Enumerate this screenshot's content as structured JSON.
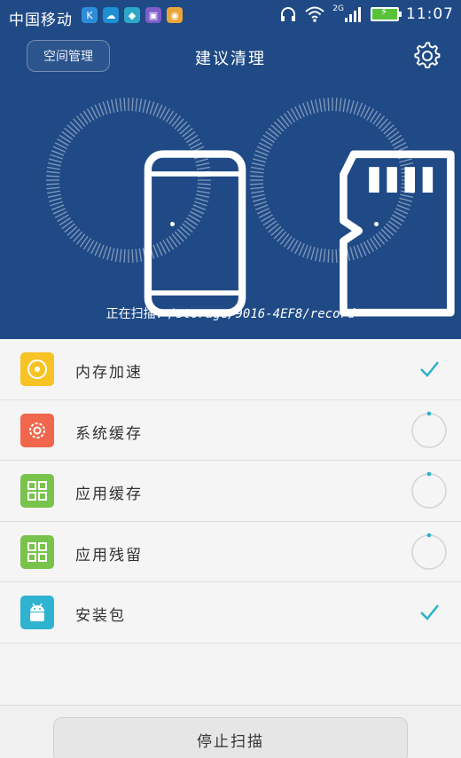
{
  "status_bar": {
    "carrier": "中国移动",
    "network_type": "2G",
    "time": "11:07",
    "app_icons": [
      {
        "icon": "circle-k-icon",
        "glyph": "K",
        "color": "#2e8ddb"
      },
      {
        "icon": "cloud-icon",
        "glyph": "☁",
        "color": "#1d8fd3"
      },
      {
        "icon": "android-store-icon",
        "glyph": "◆",
        "color": "#2ba8c7"
      },
      {
        "icon": "photo-icon",
        "glyph": "▣",
        "color": "#7e5cc9"
      },
      {
        "icon": "maps-pin-icon",
        "glyph": "◉",
        "color": "#e9a43a"
      }
    ]
  },
  "header": {
    "space_button": "空间管理",
    "title": "建议清理",
    "settings_icon": "gear-icon"
  },
  "scan": {
    "label": "正在扫描：",
    "path": "/storage/9016-4EF8/record",
    "internal_icon": "phone-icon",
    "sd_icon": "sd-card-icon"
  },
  "items": [
    {
      "label": "内存加速",
      "icon": "speed-dial-icon",
      "tile_color": "#f7c325",
      "state": "done"
    },
    {
      "label": "系统缓存",
      "icon": "gear-icon",
      "tile_color": "#f0674d",
      "state": "scanning"
    },
    {
      "label": "应用缓存",
      "icon": "grid-icon",
      "tile_color": "#79c34c",
      "state": "scanning"
    },
    {
      "label": "应用残留",
      "icon": "grid-icon",
      "tile_color": "#79c34c",
      "state": "scanning"
    },
    {
      "label": "安装包",
      "icon": "android-icon",
      "tile_color": "#2fb3d1",
      "state": "done"
    }
  ],
  "stop_button": "停止扫描",
  "colors": {
    "header_bg": "#1f4a86",
    "accent": "#2ab0cb"
  }
}
